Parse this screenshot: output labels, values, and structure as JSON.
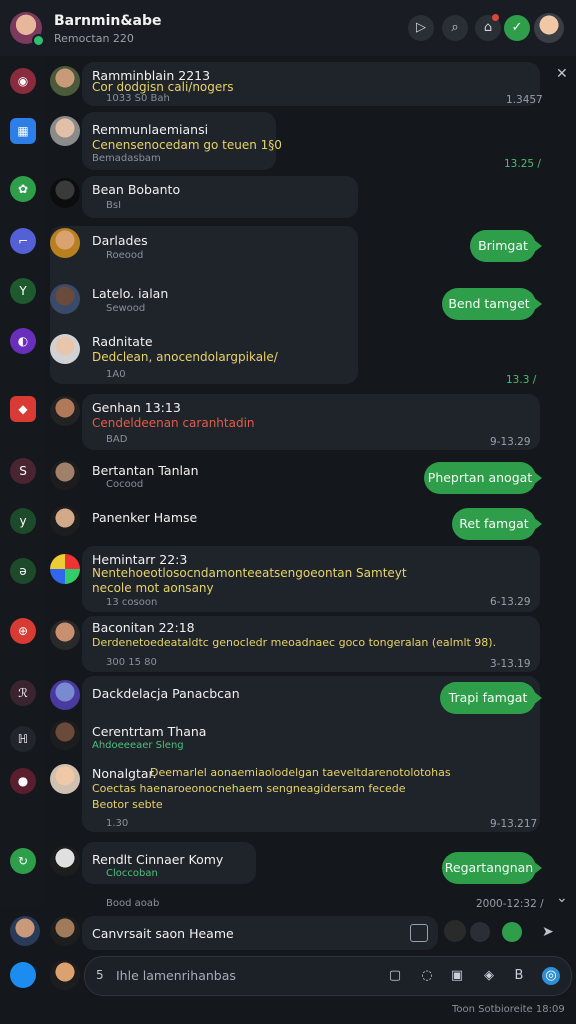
{
  "header": {
    "title": "Barnmin&abe",
    "subtitle": "Remoctan 220"
  },
  "rail_icons": [
    "chat-icon",
    "grid-icon",
    "settings-icon",
    "hash-icon",
    "y-icon",
    "compass-icon",
    "media-icon",
    "s-icon",
    "down-icon",
    "r-icon",
    "plus-icon",
    "drop-icon",
    "g-icon",
    "bird-icon"
  ],
  "threads": [
    {
      "name": "Ramminblain 2213",
      "msg": "Cor dodgisn cali/nogers",
      "meta": "1033 S0 Bah",
      "time": "1.3457"
    },
    {
      "name": "Remmunlaemiansi",
      "msg": "Cenensenocedam go teuen 1§0",
      "meta": "Bemadasbam",
      "time": "13.25 /"
    },
    {
      "name": "Bean Bobanto",
      "msg": "",
      "meta": "BsI",
      "time": ""
    },
    {
      "name": "Darlades",
      "msg": "",
      "meta": "Roeood",
      "time": ""
    },
    {
      "name": "Latelo. ialan",
      "msg": "",
      "meta": "Sewood",
      "time": ""
    },
    {
      "name": "Radnitate",
      "msg": "Dedclean, anocendolargpikale/",
      "meta": "1A0",
      "time": "13.3 /"
    },
    {
      "name": "Genhan 13:13",
      "msg": "Cendeldeenan caranhtadin",
      "meta": "BAD",
      "time": "9-13.29"
    },
    {
      "name": "Bertantan Tanlan",
      "msg": "",
      "meta": "Cocood",
      "time": ""
    },
    {
      "name": "Panenker Hamse",
      "msg": "",
      "meta": "",
      "time": ""
    },
    {
      "name": "Hemintarr 22:3",
      "msg": "Nentehoeotlosocndamonteeatsengoeontan Samteyt",
      "msg2": "necole mot aonsany",
      "meta": "13 cosoon",
      "time": "6-13.29"
    },
    {
      "name": "Baconitan 22:18",
      "msg": "Derdenetoedeataldtc genocledr meoadnaec goco tongeralan (ealmlt 98).",
      "meta": "300 15 80",
      "time": "3-13.19"
    },
    {
      "name": "Dackdelacja Panacbcan",
      "msg": "",
      "meta": "",
      "time": ""
    },
    {
      "name": "Cerentrtam Thana",
      "msg": "Ahdoeeeaer Sleng",
      "meta": "",
      "time": ""
    },
    {
      "name": "Nonalgtar.",
      "msg": "Deemarlel aonaemiaolodelgan taeveltdarenotolotohas",
      "msg2": "Coectas haenaroeonocnehaem sengneagidersam fecede",
      "msg3": "Beotor sebte",
      "meta": "1.30",
      "time": "9-13.217"
    },
    {
      "name": "Rendlt Cinnaer Komy",
      "msg": "",
      "meta": "Cloccoban",
      "time": ""
    },
    {
      "name": "Canvrsait saon Heame",
      "msg": "",
      "meta": "Bood aoab",
      "time": "2000-12:32 /"
    }
  ],
  "replies": [
    {
      "label": "Brimgat"
    },
    {
      "label": "Bend tamget"
    },
    {
      "label": "Pheprtan anogat"
    },
    {
      "label": "Ret famgat"
    },
    {
      "label": "Trapi famgat"
    },
    {
      "label": "Regartangnan"
    }
  ],
  "compose": {
    "count": "5",
    "placeholder": "Ihle lamenrihanbas"
  },
  "footer": {
    "status": "Toon Sotbioreite 18:09"
  }
}
